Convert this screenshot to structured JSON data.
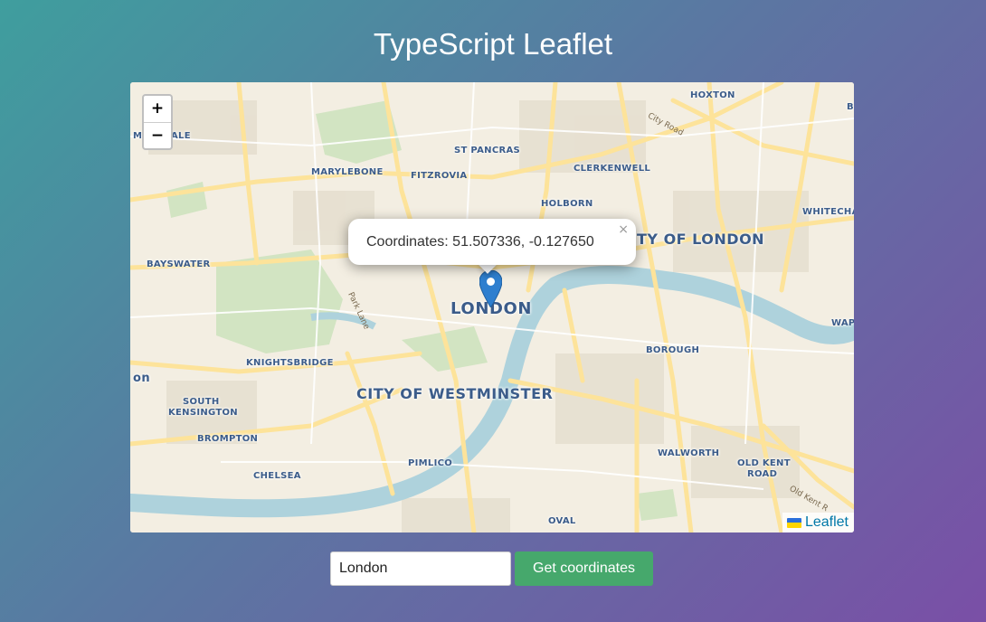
{
  "page": {
    "title": "TypeScript Leaflet"
  },
  "map": {
    "zoom_in_label": "+",
    "zoom_out_label": "−",
    "popup": {
      "text": "Coordinates: 51.507336, -0.127650",
      "close_label": "×"
    },
    "attribution": {
      "link_text": "Leaflet",
      "flag_icon": "ukraine-flag-icon"
    },
    "labels": {
      "hoxton": "HOXTON",
      "b_edge": "B",
      "marylebone_edge": "MA",
      "marylebone_edge2": "ALE",
      "st_pancras": "ST PANCRAS",
      "marylebone": "MARYLEBONE",
      "fitzrovia": "FITZROVIA",
      "clerkenwell": "CLERKENWELL",
      "holborn": "HOLBORN",
      "whitechapel": "WHITECHA",
      "city_of_london": "TY OF LONDON",
      "bayswater": "BAYSWATER",
      "london": "LONDON",
      "wapping": "WAP",
      "borough": "BOROUGH",
      "knightsbridge": "KNIGHTSBRIDGE",
      "on_edge": "on",
      "city_of_westminster": "CITY OF WESTMINSTER",
      "south_kensington_1": "SOUTH",
      "south_kensington_2": "KENSINGTON",
      "brompton": "BROMPTON",
      "walworth": "WALWORTH",
      "old_kent_1": "OLD KENT",
      "old_kent_2": "ROAD",
      "chelsea": "CHELSEA",
      "pimlico": "PIMLICO",
      "oval": "OVAL",
      "city_road": "City Road",
      "park_lane": "Park Lane",
      "old_kent_road": "Old Kent R"
    }
  },
  "form": {
    "input_value": "London",
    "button_label": "Get coordinates"
  },
  "colors": {
    "button": "#46a86c",
    "link": "#0078a8",
    "marker": "#2e7fcf",
    "map_label": "#3b5c8a",
    "river": "#aad3df",
    "park": "#cfe3bf",
    "road": "#fde39a"
  }
}
